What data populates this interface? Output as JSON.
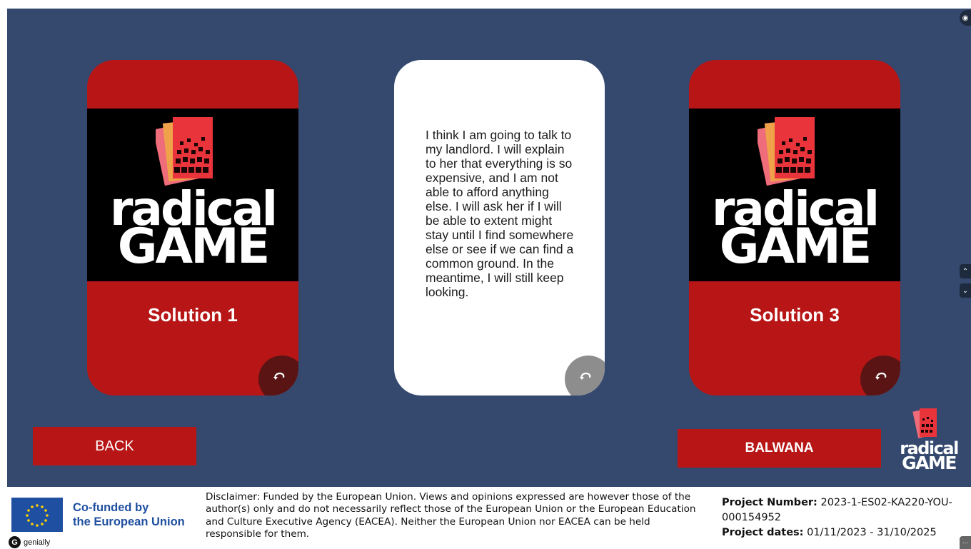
{
  "cards": [
    {
      "logo_line1": "radical",
      "logo_line2": "GAME",
      "label": "Solution 1"
    },
    {
      "text": "I think I am going to talk to my landlord. I will explain to her that everything is so expensive, and I am not able to afford anything else. I will ask her if I will be able to extent might stay until I find somewhere else or see if we can find a common ground. In the meantime, I will still keep looking."
    },
    {
      "logo_line1": "radical",
      "logo_line2": "GAME",
      "label": "Solution 3"
    }
  ],
  "buttons": {
    "back": "BACK",
    "balwana": "BALWANA"
  },
  "mini_logo": {
    "line1": "radical",
    "line2": "GAME"
  },
  "footer": {
    "eu_line1": "Co-funded by",
    "eu_line2": "the European Union",
    "genially": "genially",
    "disclaimer": "Disclaimer: Funded by the European Union. Views and opinions expressed are however those of the author(s) only and do not necessarily reflect those of the European Union or the European Education and Culture Executive Agency (EACEA). Neither the European Union nor EACEA can be held responsible for them.",
    "project_number_label": "Project Number:",
    "project_number": " 2023-1-ES02-KA220-YOU-000154952",
    "project_dates_label": "Project dates:",
    "project_dates": " 01/11/2023 - 31/10/2025"
  },
  "colors": {
    "background": "#35496f",
    "card_red": "#b71516",
    "flip_dark": "#5a1414"
  },
  "icons": [
    "flip-icon",
    "eye-icon",
    "chevron-up-icon",
    "chevron-down-icon",
    "chat-icon"
  ]
}
